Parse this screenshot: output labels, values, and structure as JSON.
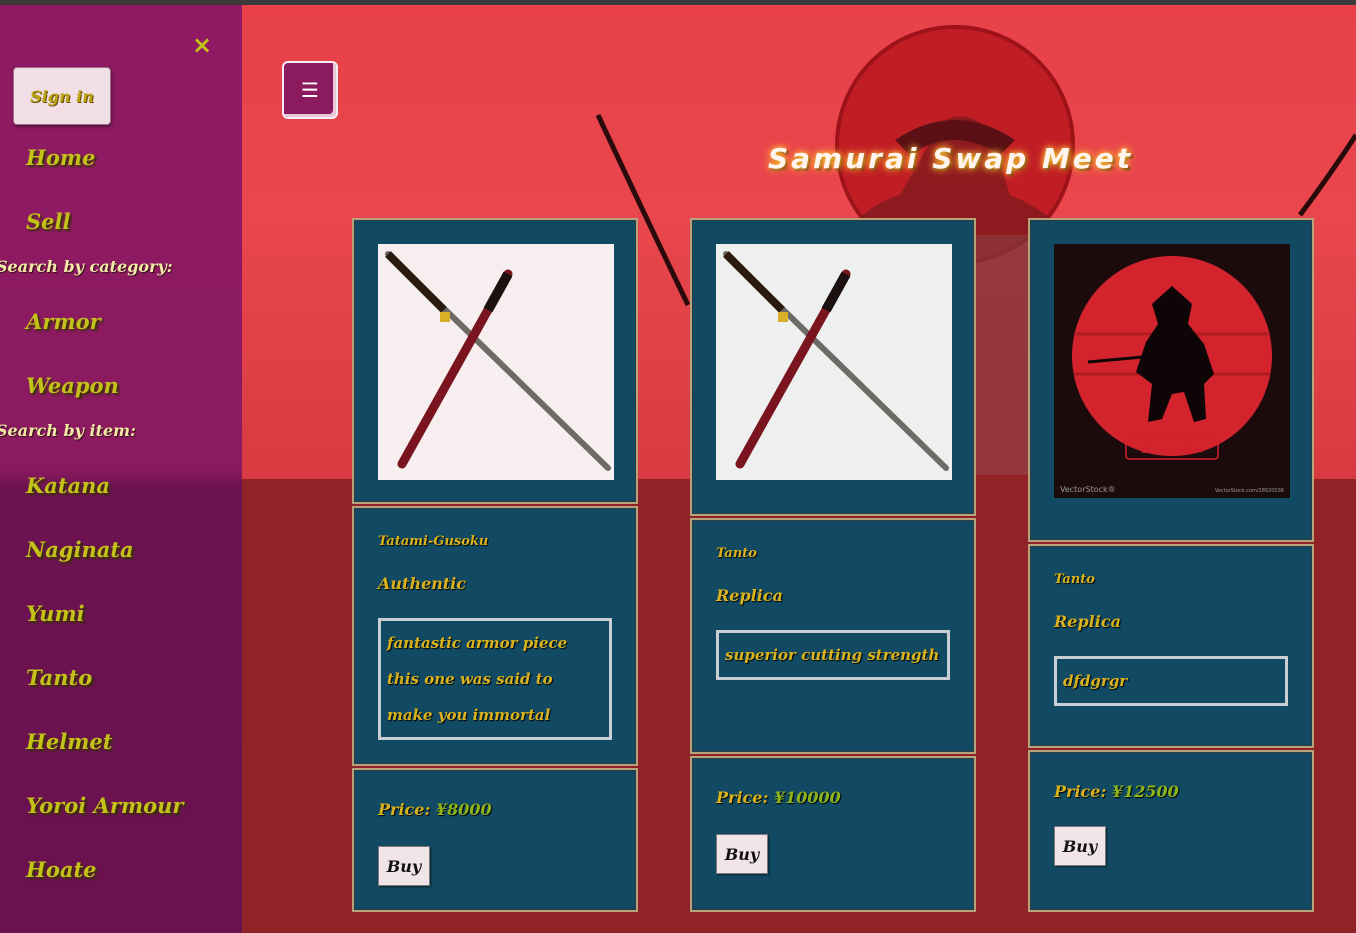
{
  "site": {
    "title": "Samurai Swap Meet"
  },
  "sidebar": {
    "close_glyph": "×",
    "sign_in": "Sign in",
    "home": "Home",
    "sell": "Sell",
    "category_heading": "Search by category:",
    "categories": [
      "Armor",
      "Weapon"
    ],
    "item_heading": "Search by item:",
    "items": [
      "Katana",
      "Naginata",
      "Yumi",
      "Tanto",
      "Helmet",
      "Yoroi Armour",
      "Hoate"
    ]
  },
  "header": {
    "menu_glyph": "☰"
  },
  "products": [
    {
      "name": "Tatami-Gusoku",
      "kind": "Authentic",
      "description": "fantastic armor piece this one was said to make you immortal",
      "price_label": "Price:",
      "price": "¥8000",
      "buy": "Buy",
      "image": "crossed-katana-image"
    },
    {
      "name": "Tanto",
      "kind": "Replica",
      "description": "superior cutting strength",
      "price_label": "Price:",
      "price": "¥10000",
      "buy": "Buy",
      "image": "crossed-katana-image"
    },
    {
      "name": "Tanto",
      "kind": "Replica",
      "description": "dfdgrgr",
      "price_label": "Price:",
      "price": "¥12500",
      "buy": "Buy",
      "image": "samurai-silhouette-image",
      "image_text": {
        "button": "LOREM IPSUM",
        "brand": "VectorStock®",
        "url": "VectorStock.com/28920036"
      }
    }
  ],
  "colors": {
    "sidebar": "#8b1a60",
    "card": "#124a63",
    "accent": "#d9b21c",
    "price": "#8fb418"
  }
}
